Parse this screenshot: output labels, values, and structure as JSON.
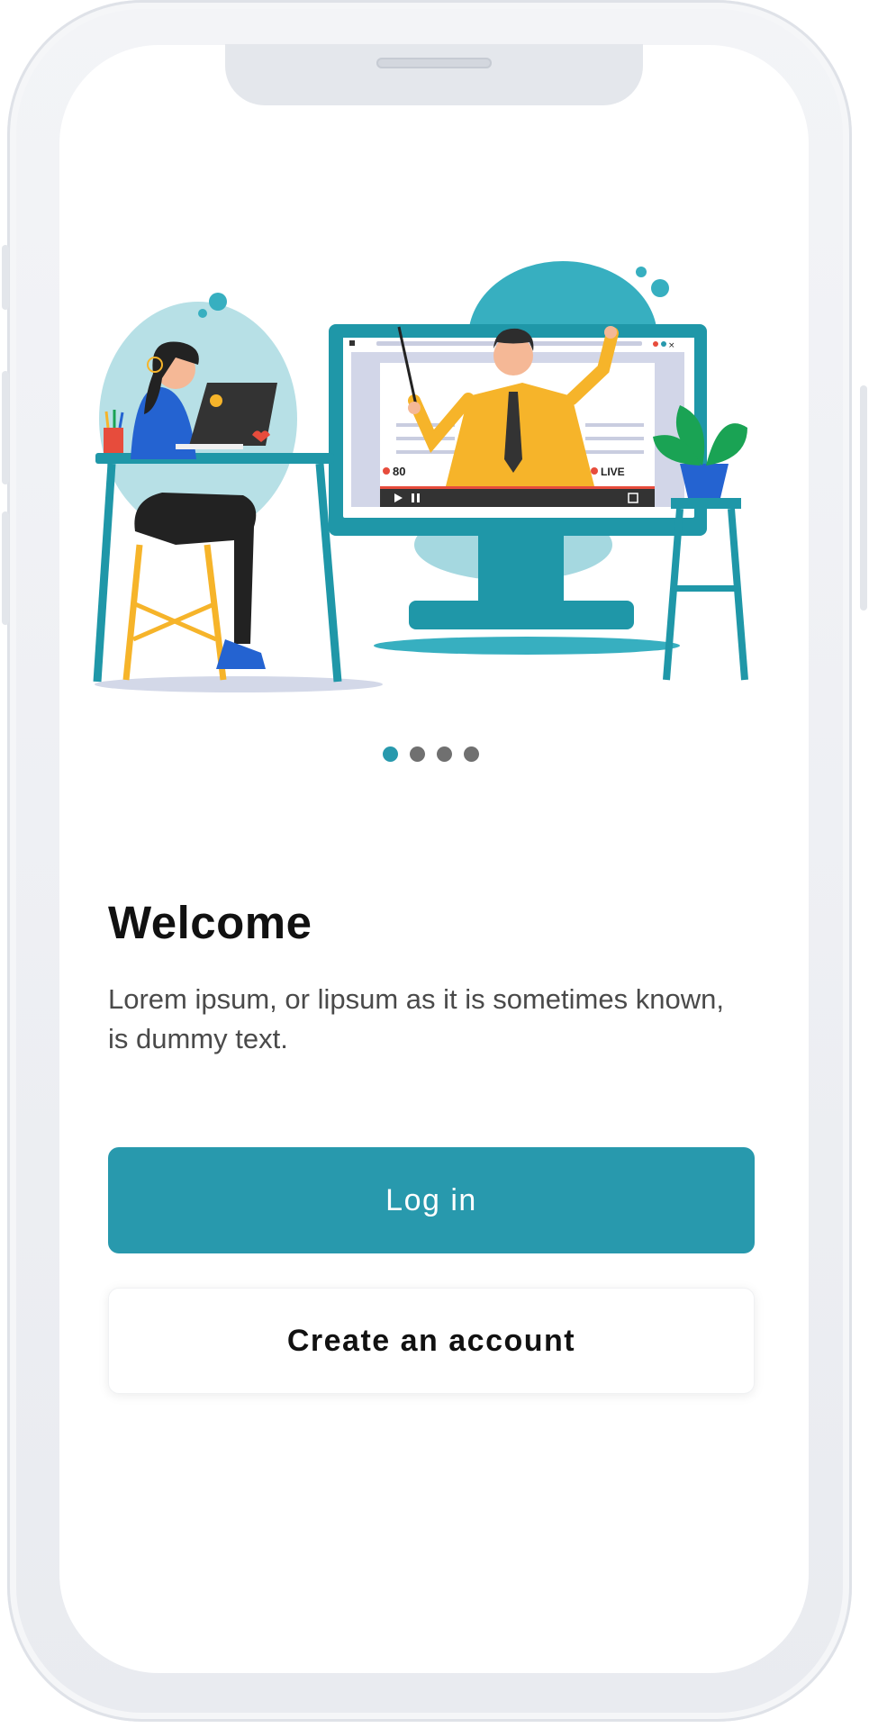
{
  "illustration": {
    "viewer_count": "80",
    "live_label": "LIVE"
  },
  "pager": {
    "total": 4,
    "active_index": 0
  },
  "welcome": {
    "title": "Welcome",
    "description": "Lorem ipsum, or lipsum as it is sometimes known, is dummy text."
  },
  "actions": {
    "login_label": "Log in",
    "create_account_label": "Create an account"
  },
  "colors": {
    "accent": "#2899ad",
    "dot_inactive": "#707070",
    "title": "#111111",
    "body_text": "#4a4a4a"
  }
}
